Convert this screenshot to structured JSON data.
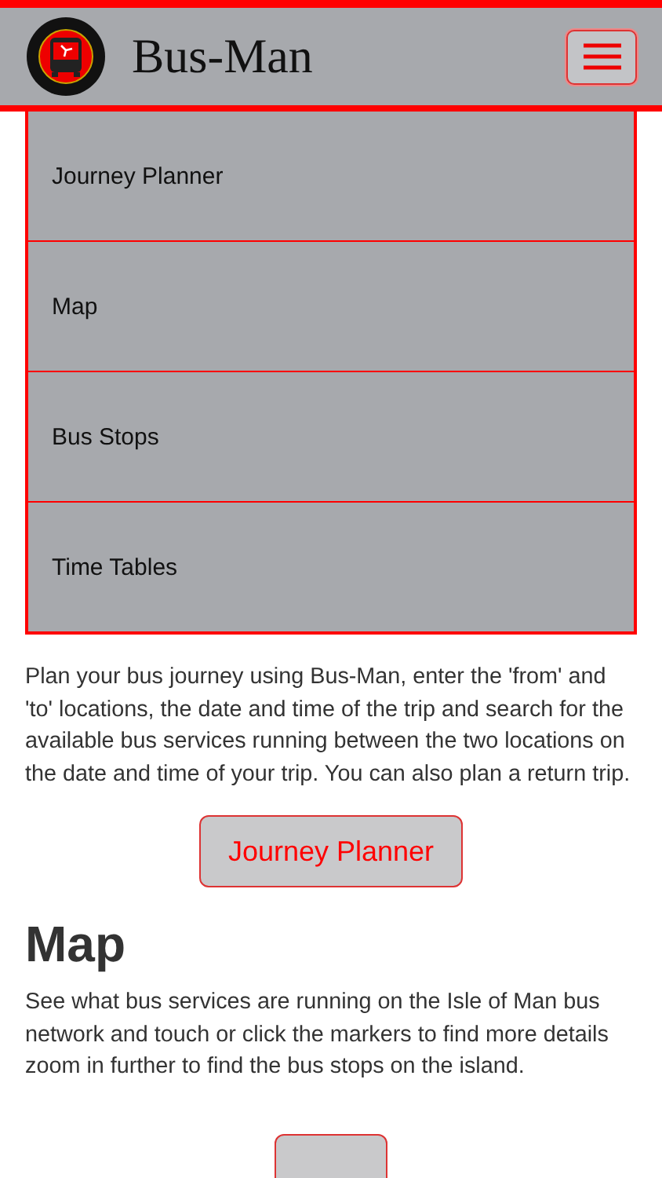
{
  "header": {
    "title": "Bus-Man"
  },
  "menu": {
    "expanded": true,
    "items": [
      {
        "label": "Journey Planner"
      },
      {
        "label": "Map"
      },
      {
        "label": "Bus Stops"
      },
      {
        "label": "Time Tables"
      }
    ]
  },
  "sections": [
    {
      "text": "Plan your bus journey using Bus-Man, enter the 'from' and 'to' locations, the date and time of the trip and search for the available bus services running between the two locations on the date and time of your trip. You can also plan a return trip.",
      "button": "Journey Planner"
    },
    {
      "heading": "Map",
      "text": "See what bus services are running on the Isle of Man bus network and touch or click the markers to find more details zoom in further to find the bus stops on the island.",
      "button_cut": true
    }
  ]
}
